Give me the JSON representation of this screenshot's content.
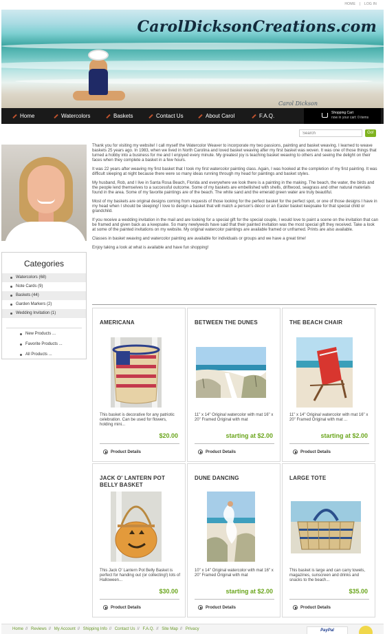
{
  "top_links": [
    "HOME",
    "|",
    "LOG IN"
  ],
  "banner": {
    "site_name": "CarolDicksonCreations.com",
    "signature": "Carol Dickson"
  },
  "nav": {
    "items": [
      {
        "label": "Home"
      },
      {
        "label": "Watercolors"
      },
      {
        "label": "Baskets"
      },
      {
        "label": "Contact Us"
      },
      {
        "label": "About Carol"
      },
      {
        "label": "F.A.Q."
      }
    ],
    "cart": {
      "title": "Shopping Cart",
      "status": "now in your cart: 0 items"
    }
  },
  "search": {
    "placeholder": "Search",
    "button": "Go!"
  },
  "sidebar": {
    "title": "Categories",
    "categories": [
      {
        "label": "Watercolors",
        "count": "(68)"
      },
      {
        "label": "Note Cards",
        "count": "(9)"
      },
      {
        "label": "Baskets",
        "count": "(44)"
      },
      {
        "label": "Garden Markers",
        "count": "(2)"
      },
      {
        "label": "Wedding Invitation",
        "count": "(1)"
      }
    ],
    "links": [
      "New Products ...",
      "Favorite Products ...",
      "All Products ..."
    ]
  },
  "intro": [
    "Thank you for visiting my website! I call myself the Watercolor Weaver to incorporate my two passions, painting and basket weaving. I learned to weave baskets 25 years ago. In 1983, when we lived in North Carolina and loved basket weaving after my first basket was woven. It was one of those things that turned a hobby into a business for me and I enjoyed every minute. My greatest joy is teaching basket weaving to others and seeing the delight on their faces when they complete a basket in a few hours.",
    "It was 22 years after weaving my first basket that I took my first watercolor painting class. Again, I was hooked at the completion of my first painting. It was difficult sleeping at night because there were so many ideas running through my head for paintings and basket styles.",
    "My husband, Rob, and I live in Santa Rosa Beach, Florida and everywhere we look there is a painting in the making. The beach, the water, the birds and the people lend themselves to a successful outcome. Some of my baskets are embellished with shells, driftwood, seagrass and other natural materials found in the area. Some of my favorite paintings are of the beach. The white sand and the emerald green water are truly beautiful.",
    "Most of my baskets are original designs coming from requests of those looking for the perfect basket for the perfect spot, or one of those designs I have in my head when I should be sleeping! I love to design a basket that will match a person's décor or an Easter basket keepsake for that special child or grandchild.",
    "If you receive a wedding invitation in the mail and are looking for a special gift for the special couple, I would love to paint a scene on the invitation that can be framed and given back as a keepsake. So many newlyweds have said that their painted invitation was the most special gift they received. Take a look at some of the painted invitations on my website. My original watercolor paintings are available framed or unframed. Prints are also available.",
    "Classes in basket weaving and watercolor painting are available for individuals or groups and we have a great time!",
    "Enjoy taking a look at what is available and have fun shopping!"
  ],
  "products": [
    {
      "title": "AMERICANA",
      "desc": "This basket is decorative for any patriotic celebration. Can be used for flowers, holding mini...",
      "price": "$20.00",
      "details": "Product Details",
      "image": "americana-basket"
    },
    {
      "title": "BETWEEN THE DUNES",
      "desc": "11\" x 14\"  Original watercolor with mat  16\" x 20\"  Framed Original with mat",
      "price": "starting at $2.00",
      "details": "Product Details",
      "image": "dunes-painting"
    },
    {
      "title": "THE BEACH CHAIR",
      "desc": "11\" x 14\"  Original watercolor with mat  16\" x 20\"  Framed Original with mat ...",
      "price": "starting at $2.00",
      "details": "Product Details",
      "image": "beach-chair-painting"
    },
    {
      "title": "JACK O' LANTERN POT BELLY BASKET",
      "desc": "This Jack O' Lantern Pot Belly Basket is perfect for handing out (or collecting!) lots of Halloween...",
      "price": "$30.00",
      "details": "Product Details",
      "image": "pumpkin-basket"
    },
    {
      "title": "DUNE DANCING",
      "desc": "10\" x 14\"  Original watercolor with mat  16\" x 20\"  Framed Original with mat",
      "price": "starting at $2.00",
      "details": "Product Details",
      "image": "dune-dancing-painting"
    },
    {
      "title": "LARGE TOTE",
      "desc": "This basket is large and can carry towels, magazines, sunscreen and drinks and snacks to the beach...",
      "price": "$35.00",
      "details": "Product Details",
      "image": "tote-basket"
    }
  ],
  "footer": {
    "links": [
      "Home",
      "Reviews",
      "My Account",
      "Shipping Info",
      "Contact Us",
      "F.A.Q.",
      "Site Map",
      "Privacy"
    ],
    "paypal": "PayPal"
  }
}
